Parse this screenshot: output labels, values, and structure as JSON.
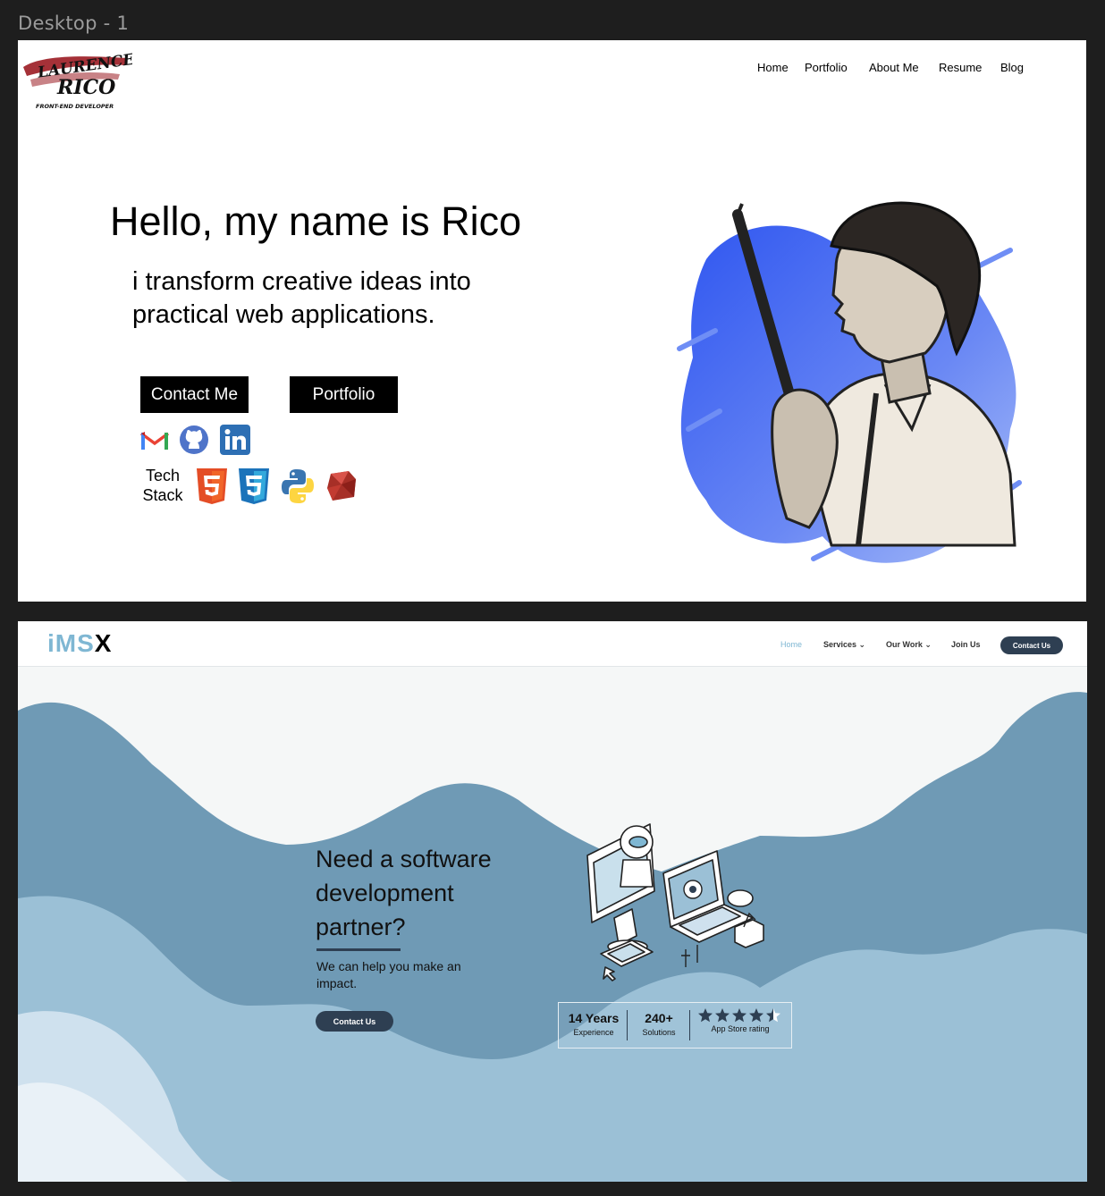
{
  "canvas": {
    "frame_label": "Desktop - 1"
  },
  "portfolio": {
    "logo": {
      "line1": "LAURENCE",
      "line2": "RICO",
      "tagline": "FRONT-END DEVELOPER"
    },
    "nav": [
      "Home",
      "Portfolio",
      "About Me",
      "Resume",
      "Blog"
    ],
    "hero": {
      "title": "Hello, my name is Rico",
      "subtitle": "i transform creative ideas into practical web applications."
    },
    "buttons": {
      "contact": "Contact Me",
      "portfolio": "Portfolio"
    },
    "social_icons": [
      "gmail-icon",
      "github-icon",
      "linkedin-icon"
    ],
    "tech_stack": {
      "label": "Tech Stack",
      "icons": [
        "html5-icon",
        "css3-icon",
        "python-icon",
        "ruby-icon"
      ]
    },
    "colors": {
      "accent_blue": "#3b62f0",
      "logo_red": "#9b1b22"
    }
  },
  "imsx": {
    "brand": {
      "part1": "iMS",
      "part2": "X"
    },
    "nav": [
      {
        "label": "Home",
        "active": true
      },
      {
        "label": "Services ⌄",
        "active": false
      },
      {
        "label": "Our Work ⌄",
        "active": false
      },
      {
        "label": "Join Us",
        "active": false
      }
    ],
    "nav_cta": "Contact Us",
    "hero": {
      "headline": "Need a software development partner?",
      "subtext": "We can help you make an impact.",
      "cta": "Contact Us"
    },
    "stats": [
      {
        "value": "14 Years",
        "label": "Experience"
      },
      {
        "value": "240+",
        "label": "Solutions"
      },
      {
        "value": "",
        "label": "App Store rating",
        "rating": 4.5,
        "rating_max": 5
      }
    ],
    "colors": {
      "primary": "#2e3f52",
      "accent": "#7fb7d3",
      "cloud_dark": "#6f9ab5",
      "cloud_mid": "#9bc0d6",
      "cloud_light": "#cfe1ee"
    }
  }
}
